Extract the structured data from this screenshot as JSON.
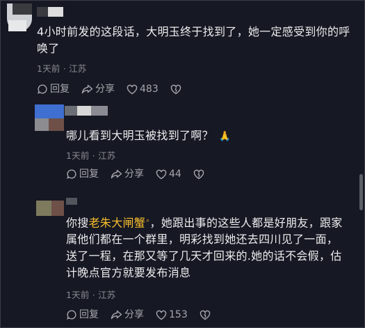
{
  "comments": [
    {
      "text": "4小时前发的这段话，大明玉终于找到了，她一定感受到你的呼唤了",
      "meta": "1天前 · 江苏",
      "actions": {
        "reply": "回复",
        "share": "分享",
        "likes": "483"
      }
    },
    {
      "text": "哪儿看到大明玉被找到了啊？",
      "emoji": "🙏",
      "meta": "1天前 · 江苏",
      "actions": {
        "reply": "回复",
        "share": "分享",
        "likes": "44"
      }
    },
    {
      "text_before": "你搜",
      "highlight": "老朱大闸蟹",
      "text_after": "，她跟出事的这些人都是好朋友，跟家属他们都在一个群里，明彩找到她还去四川见了一面，送了一程，在那又等了几天才回来的.她的话不会假，估计晚点官方就要发布消息",
      "meta": "1天前 · 江苏",
      "actions": {
        "reply": "回复",
        "share": "分享",
        "likes": "153"
      }
    }
  ],
  "colors": {
    "background": "#161823",
    "text": "#ececee",
    "meta": "#8a8b93",
    "highlight": "#f7bd2d"
  }
}
